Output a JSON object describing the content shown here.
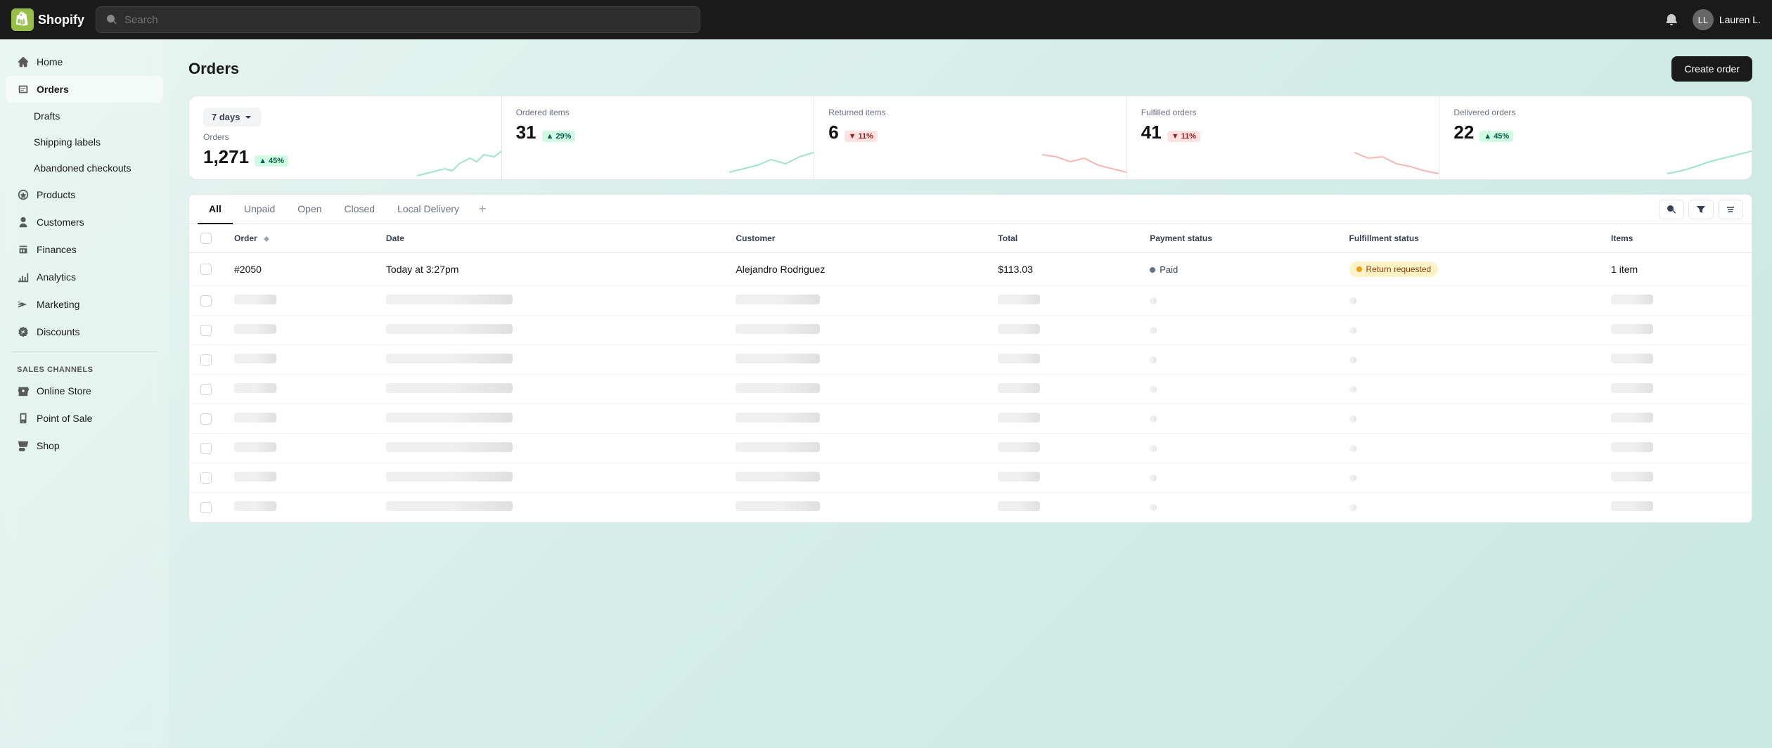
{
  "app": {
    "name": "Shopify",
    "title": "Orders",
    "create_order_label": "Create order"
  },
  "topnav": {
    "search_placeholder": "Search",
    "user_name": "Lauren L.",
    "user_initials": "LL"
  },
  "sidebar": {
    "items": [
      {
        "id": "home",
        "label": "Home",
        "icon": "home"
      },
      {
        "id": "orders",
        "label": "Orders",
        "icon": "orders",
        "active": true
      },
      {
        "id": "drafts",
        "label": "Drafts",
        "icon": "drafts",
        "indent": true
      },
      {
        "id": "shipping-labels",
        "label": "Shipping labels",
        "icon": "label",
        "indent": true
      },
      {
        "id": "abandoned-checkouts",
        "label": "Abandoned checkouts",
        "icon": "cart",
        "indent": true
      },
      {
        "id": "products",
        "label": "Products",
        "icon": "products"
      },
      {
        "id": "customers",
        "label": "Customers",
        "icon": "customers"
      },
      {
        "id": "finances",
        "label": "Finances",
        "icon": "finances"
      },
      {
        "id": "analytics",
        "label": "Analytics",
        "icon": "analytics"
      },
      {
        "id": "marketing",
        "label": "Marketing",
        "icon": "marketing"
      },
      {
        "id": "discounts",
        "label": "Discounts",
        "icon": "discounts"
      }
    ],
    "sales_channels_label": "Sales channels",
    "channels": [
      {
        "id": "online-store",
        "label": "Online Store",
        "icon": "store"
      },
      {
        "id": "point-of-sale",
        "label": "Point of Sale",
        "icon": "pos"
      },
      {
        "id": "shop",
        "label": "Shop",
        "icon": "shop"
      }
    ]
  },
  "stats": {
    "period": {
      "label": "7 days",
      "value": "7 days"
    },
    "cards": [
      {
        "id": "orders",
        "label": "Orders",
        "value": "1,271",
        "change": "45%",
        "change_type": "up"
      },
      {
        "id": "ordered-items",
        "label": "Ordered items",
        "value": "31",
        "change": "29%",
        "change_type": "up"
      },
      {
        "id": "returned-items",
        "label": "Returned items",
        "value": "6",
        "change": "11%",
        "change_type": "down"
      },
      {
        "id": "fulfilled-orders",
        "label": "Fulfilled orders",
        "value": "41",
        "change": "11%",
        "change_type": "down"
      },
      {
        "id": "delivered-orders",
        "label": "Delivered orders",
        "value": "22",
        "change": "45%",
        "change_type": "up"
      }
    ]
  },
  "tabs": {
    "items": [
      {
        "id": "all",
        "label": "All",
        "active": true
      },
      {
        "id": "unpaid",
        "label": "Unpaid",
        "active": false
      },
      {
        "id": "open",
        "label": "Open",
        "active": false
      },
      {
        "id": "closed",
        "label": "Closed",
        "active": false
      },
      {
        "id": "local-delivery",
        "label": "Local Delivery",
        "active": false
      }
    ]
  },
  "table": {
    "columns": [
      {
        "id": "order",
        "label": "Order"
      },
      {
        "id": "date",
        "label": "Date"
      },
      {
        "id": "customer",
        "label": "Customer"
      },
      {
        "id": "total",
        "label": "Total"
      },
      {
        "id": "payment-status",
        "label": "Payment status"
      },
      {
        "id": "fulfillment-status",
        "label": "Fulfillment status"
      },
      {
        "id": "items",
        "label": "Items"
      }
    ],
    "rows": [
      {
        "id": "row-1",
        "order": "#2050",
        "date": "Today at 3:27pm",
        "customer": "Alejandro Rodriguez",
        "total": "$113.03",
        "payment_status": "Paid",
        "payment_type": "paid",
        "fulfillment_status": "Return requested",
        "fulfillment_type": "return",
        "items": "1 item",
        "skeleton": false
      },
      {
        "id": "row-2",
        "skeleton": true
      },
      {
        "id": "row-3",
        "skeleton": true
      },
      {
        "id": "row-4",
        "skeleton": true
      },
      {
        "id": "row-5",
        "skeleton": true
      },
      {
        "id": "row-6",
        "skeleton": true
      },
      {
        "id": "row-7",
        "skeleton": true
      },
      {
        "id": "row-8",
        "skeleton": true
      },
      {
        "id": "row-9",
        "skeleton": true
      }
    ]
  },
  "colors": {
    "accent": "#1a1a1a",
    "green_badge_bg": "#d1fae5",
    "green_badge_text": "#065f46",
    "red_badge_bg": "#fee2e2",
    "red_badge_text": "#991b1b",
    "return_badge_bg": "#fef3c7",
    "return_badge_text": "#92400e"
  }
}
